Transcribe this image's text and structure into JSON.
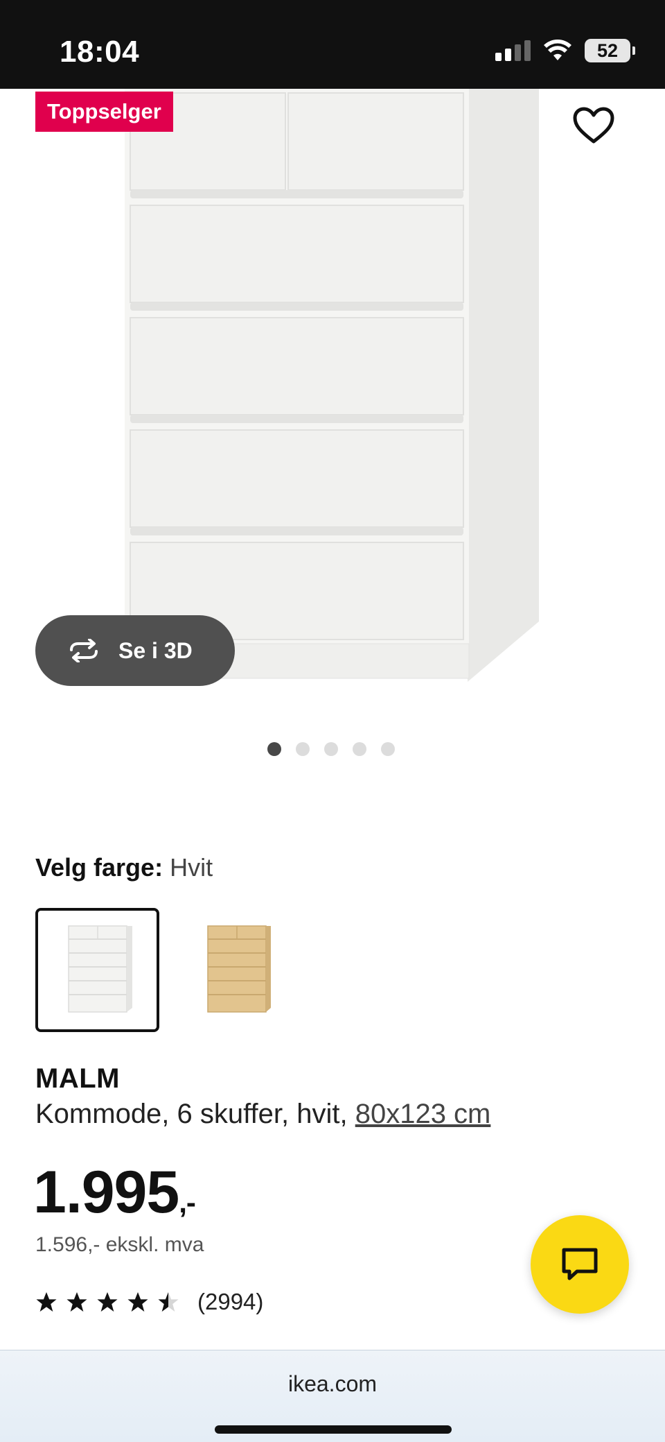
{
  "status_bar": {
    "time": "18:04",
    "battery": "52"
  },
  "product_image": {
    "badge": "Toppselger",
    "view_3d_label": "Se i 3D",
    "carousel": {
      "count": 5,
      "active_index": 0
    }
  },
  "color": {
    "label": "Velg farge:",
    "value": "Hvit",
    "swatches": [
      {
        "name": "white",
        "color": "#f3f3f1",
        "selected": true
      },
      {
        "name": "oak",
        "color": "#e2c48e",
        "selected": false
      }
    ]
  },
  "product": {
    "name": "MALM",
    "description": "Kommode, 6 skuffer, hvit, ",
    "dimensions_link": "80x123 cm",
    "price_main": "1.995",
    "price_suffix": ",-",
    "price_ex_vat": "1.596,- ekskl. mva",
    "rating_value": 4.5,
    "rating_max": 5,
    "rating_count": "(2994)"
  },
  "browser": {
    "url": "ikea.com"
  },
  "colors": {
    "badge": "#e0004d",
    "chat_fab": "#fad914",
    "status_bar": "#111111"
  },
  "icons": [
    "heart-icon",
    "rotate-3d-icon",
    "chat-icon",
    "star-icon",
    "wifi-icon",
    "signal-icon",
    "battery-icon"
  ]
}
